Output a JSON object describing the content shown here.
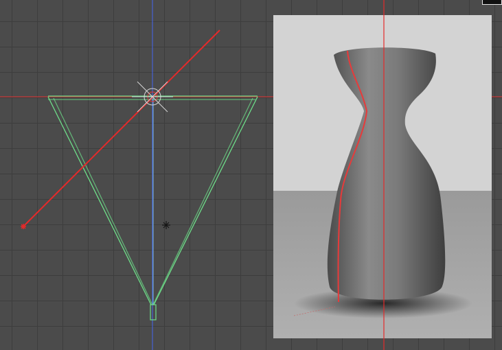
{
  "viewport": {
    "view": "top",
    "grid_visible": true
  },
  "colors": {
    "background": "#4b4b4b",
    "grid": "#3d3d3d",
    "camera_frustum": "#6ee08a",
    "world_x_axis": "#e53333",
    "world_y_axis": "#4466ee",
    "light_direction": "#e62a2a",
    "render_background": "#d0d0d0",
    "vase": "#6a6a6a"
  },
  "icons": {
    "camera_target": "crosshair-circle-icon",
    "light": "light-marker-icon",
    "pivot": "asterisk-pivot-icon",
    "camera_body": "camera-icon"
  },
  "render_preview": {
    "object": "vase",
    "seam_visible": true
  }
}
